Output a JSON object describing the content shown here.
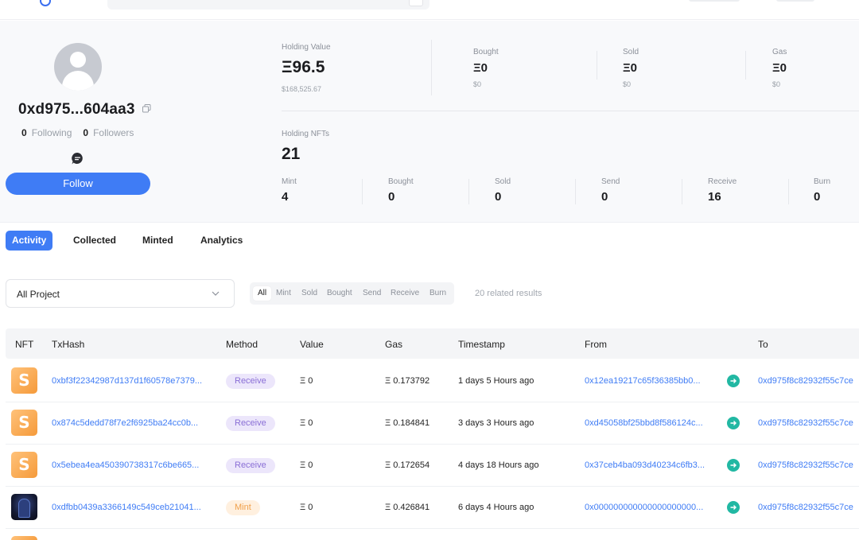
{
  "colors": {
    "accent": "#3f7cf5",
    "receive_bg": "#ece6fb",
    "receive_fg": "#8a6fd6",
    "mint_bg": "#fff0df",
    "mint_fg": "#f0a04b",
    "arrow": "#22b8a3"
  },
  "profile": {
    "address": "0xd975...604aa3",
    "following_count": "0",
    "following_label": "Following",
    "followers_count": "0",
    "followers_label": "Followers",
    "follow_button": "Follow"
  },
  "holdings": {
    "holding_value_label": "Holding Value",
    "holding_value": "Ξ96.5",
    "holding_value_usd": "$168,525.67",
    "bought_label": "Bought",
    "bought_value": "Ξ0",
    "bought_usd": "$0",
    "sold_label": "Sold",
    "sold_value": "Ξ0",
    "sold_usd": "$0",
    "gas_label": "Gas",
    "gas_value": "Ξ0",
    "gas_usd": "$0",
    "holding_nfts_label": "Holding NFTs",
    "holding_nfts": "21",
    "counts": [
      {
        "label": "Mint",
        "value": "4"
      },
      {
        "label": "Bought",
        "value": "0"
      },
      {
        "label": "Sold",
        "value": "0"
      },
      {
        "label": "Send",
        "value": "0"
      },
      {
        "label": "Receive",
        "value": "16"
      },
      {
        "label": "Burn",
        "value": "0"
      }
    ]
  },
  "tabs": [
    "Activity",
    "Collected",
    "Minted",
    "Analytics"
  ],
  "filters": {
    "project_select": "All Project",
    "types": [
      "All",
      "Mint",
      "Sold",
      "Bought",
      "Send",
      "Receive",
      "Burn"
    ],
    "results": "20 related results"
  },
  "table": {
    "headers": [
      "NFT",
      "TxHash",
      "Method",
      "Value",
      "Gas",
      "Timestamp",
      "From",
      "To"
    ],
    "rows": [
      {
        "nft_icon": "orange-s-token",
        "txhash": "0xbf3f22342987d137d1f60578e7379...",
        "method": "Receive",
        "value": "Ξ 0",
        "gas": "Ξ 0.173792",
        "timestamp": "1 days 5 Hours ago",
        "from": "0x12ea19217c65f36385bb0...",
        "to": "0xd975f8c82932f55c7ce"
      },
      {
        "nft_icon": "orange-s-token",
        "txhash": "0x874c5dedd78f7e2f6925ba24cc0b...",
        "method": "Receive",
        "value": "Ξ 0",
        "gas": "Ξ 0.184841",
        "timestamp": "3 days 3 Hours ago",
        "from": "0xd45058bf25bbd8f586124c...",
        "to": "0xd975f8c82932f55c7ce"
      },
      {
        "nft_icon": "orange-s-token",
        "txhash": "0x5ebea4ea450390738317c6be665...",
        "method": "Receive",
        "value": "Ξ 0",
        "gas": "Ξ 0.172654",
        "timestamp": "4 days 18 Hours ago",
        "from": "0x37ceb4ba093d40234c6fb3...",
        "to": "0xd975f8c82932f55c7ce"
      },
      {
        "nft_icon": "dark-figure-nft",
        "txhash": "0xdfbb0439a3366149c549ceb21041...",
        "method": "Mint",
        "value": "Ξ 0",
        "gas": "Ξ 0.426841",
        "timestamp": "6 days 4 Hours ago",
        "from": "0x000000000000000000000...",
        "to": "0xd975f8c82932f55c7ce"
      }
    ]
  }
}
